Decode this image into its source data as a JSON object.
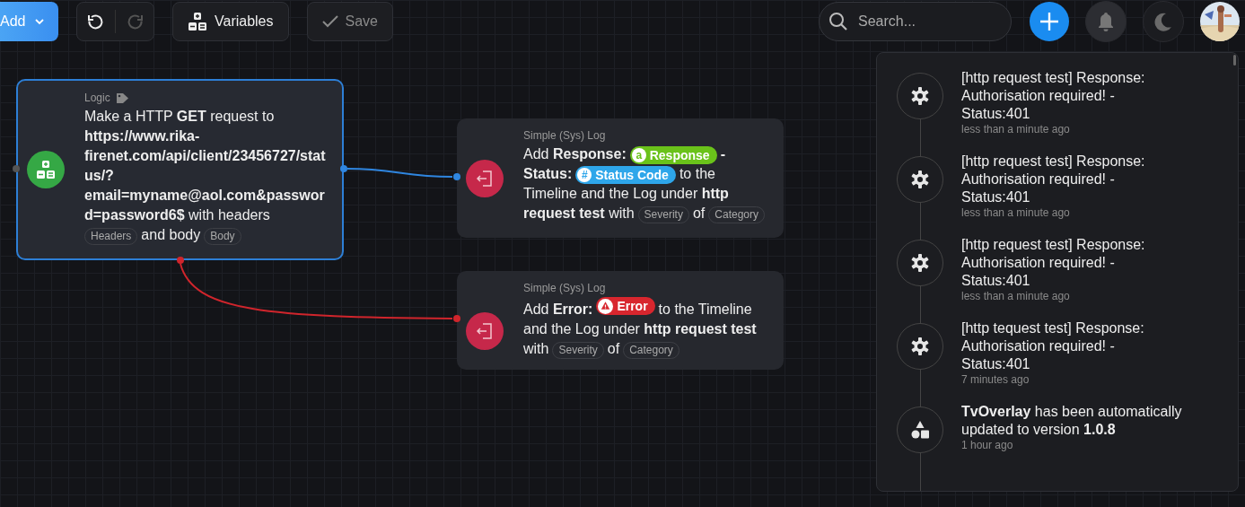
{
  "toolbar": {
    "add_label": "Add",
    "undo_disabled": false,
    "redo_disabled": true,
    "variables_label": "Variables",
    "save_label": "Save",
    "save_disabled": true
  },
  "search": {
    "placeholder": "Search..."
  },
  "notifications_open": true,
  "nodes": [
    {
      "kind": "logic",
      "category": "Logic",
      "segments": [
        {
          "kind": "text",
          "text": "Make a HTTP **GET** request to **https://www.rika-firenet.com/api/client/23456727/status/?email=myname@aol.com&password=password6$** with headers"
        },
        {
          "kind": "tag",
          "text": "Headers"
        },
        {
          "kind": "text",
          "text": "and body"
        },
        {
          "kind": "tag",
          "text": "Body"
        }
      ]
    },
    {
      "kind": "log",
      "category": "Simple (Sys) Log",
      "on_error": false,
      "segments": [
        {
          "kind": "text",
          "text": "Add **Response:**"
        },
        {
          "kind": "chip",
          "glyph": "a",
          "text": "Response",
          "color": "#6ac21a"
        },
        {
          "kind": "text",
          "text": "**- Status:**"
        },
        {
          "kind": "chip",
          "glyph": "#",
          "text": "Status Code",
          "color": "#2ea6ea"
        },
        {
          "kind": "text",
          "text": "to the Timeline and the Log under **http request test** with"
        },
        {
          "kind": "tag",
          "text": "Severity"
        },
        {
          "kind": "text",
          "text": "of"
        },
        {
          "kind": "tag",
          "text": "Category"
        }
      ]
    },
    {
      "kind": "log",
      "category": "Simple (Sys) Log",
      "on_error": true,
      "segments": [
        {
          "kind": "text",
          "text": "Add **Error:**"
        },
        {
          "kind": "alert-chip",
          "text": "Error",
          "color": "#d8262e"
        },
        {
          "kind": "text",
          "text": "to the Timeline and the Log under **http request test** with"
        },
        {
          "kind": "tag",
          "text": "Severity"
        },
        {
          "kind": "text",
          "text": "of"
        },
        {
          "kind": "tag",
          "text": "Category"
        }
      ]
    }
  ],
  "notifications": [
    {
      "kind": "system",
      "text": "[http request test] Response: Authorisation required! - Status:401",
      "time": "less than a minute ago"
    },
    {
      "kind": "system",
      "text": "[http request test] Response: Authorisation required! - Status:401",
      "time": "less than a minute ago"
    },
    {
      "kind": "system",
      "text": "[http request test] Response: Authorisation required! - Status:401",
      "time": "less than a minute ago"
    },
    {
      "kind": "system",
      "text": "[http tequest test] Response: Authorisation required! - Status:401",
      "time": "7 minutes ago"
    },
    {
      "kind": "app",
      "text": "**TvOverlay** has been automatically updated to version **1.0.8**",
      "time": "1 hour ago"
    }
  ]
}
